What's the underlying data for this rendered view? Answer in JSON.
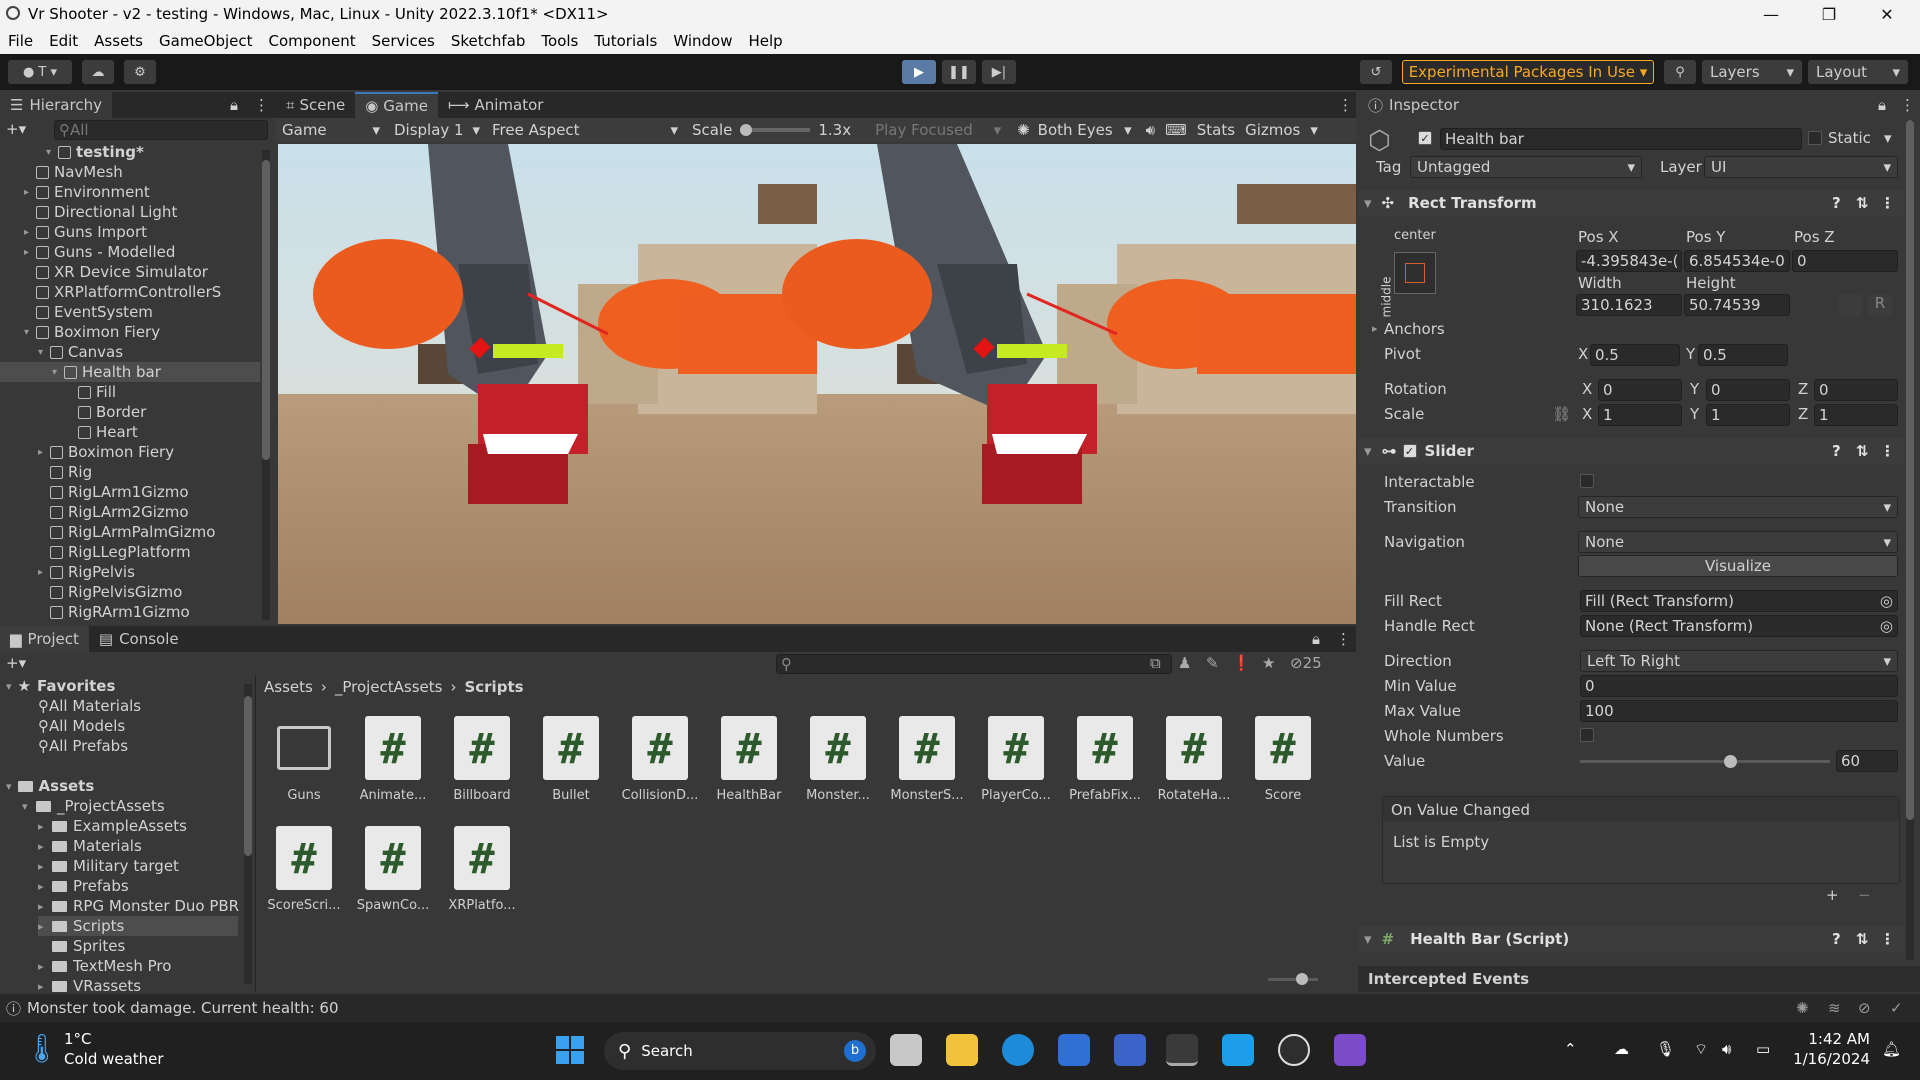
{
  "window": {
    "title": "Vr Shooter - v2 - testing - Windows, Mac, Linux - Unity 2022.3.10f1* <DX11>"
  },
  "menu": [
    "File",
    "Edit",
    "Assets",
    "GameObject",
    "Component",
    "Services",
    "Sketchfab",
    "Tools",
    "Tutorials",
    "Window",
    "Help"
  ],
  "toolbar": {
    "account": "T",
    "experimental": "Experimental Packages In Use",
    "layers": "Layers",
    "layout": "Layout"
  },
  "hierarchy": {
    "title": "Hierarchy",
    "search_placeholder": "All",
    "items": [
      {
        "label": "testing*",
        "depth": 0
      },
      {
        "label": "NavMesh",
        "depth": 1
      },
      {
        "label": "Environment",
        "depth": 1
      },
      {
        "label": "Directional Light",
        "depth": 1
      },
      {
        "label": "Guns Import",
        "depth": 1
      },
      {
        "label": "Guns - Modelled",
        "depth": 1
      },
      {
        "label": "XR Device Simulator",
        "depth": 1
      },
      {
        "label": "XRPlatformControllerS",
        "depth": 1
      },
      {
        "label": "EventSystem",
        "depth": 1
      },
      {
        "label": "Boximon Fiery",
        "depth": 1
      },
      {
        "label": "Canvas",
        "depth": 2
      },
      {
        "label": "Health bar",
        "depth": 3
      },
      {
        "label": "Fill",
        "depth": 4
      },
      {
        "label": "Border",
        "depth": 4
      },
      {
        "label": "Heart",
        "depth": 4
      },
      {
        "label": "Boximon Fiery",
        "depth": 2
      },
      {
        "label": "Rig",
        "depth": 2
      },
      {
        "label": "RigLArm1Gizmo",
        "depth": 2
      },
      {
        "label": "RigLArm2Gizmo",
        "depth": 2
      },
      {
        "label": "RigLArmPalmGizmo",
        "depth": 2
      },
      {
        "label": "RigLLegPlatform",
        "depth": 2
      },
      {
        "label": "RigPelvis",
        "depth": 2
      },
      {
        "label": "RigPelvisGizmo",
        "depth": 2
      },
      {
        "label": "RigRArm1Gizmo",
        "depth": 2
      }
    ]
  },
  "view_tabs": [
    "Scene",
    "Game",
    "Animator"
  ],
  "game_bar": {
    "mode": "Game",
    "display": "Display 1",
    "aspect": "Free Aspect",
    "scale_label": "Scale",
    "scale_value": "1.3x",
    "play_focused": "Play Focused",
    "eyes": "Both Eyes",
    "stats": "Stats",
    "gizmos": "Gizmos"
  },
  "project": {
    "tabs": [
      "Project",
      "Console"
    ],
    "count": "25",
    "breadcrumb": [
      "Assets",
      "_ProjectAssets",
      "Scripts"
    ],
    "favorites_title": "Favorites",
    "favorites": [
      "All Materials",
      "All Models",
      "All Prefabs"
    ],
    "assets_title": "Assets",
    "folders": [
      "_ProjectAssets",
      "ExampleAssets",
      "Materials",
      "Military target",
      "Prefabs",
      "RPG Monster Duo PBR",
      "Scripts",
      "Sprites",
      "TextMesh Pro",
      "VRassets"
    ],
    "items": [
      "Guns",
      "Animate...",
      "Billboard",
      "Bullet",
      "CollisionD...",
      "HealthBar",
      "Monster...",
      "MonsterS...",
      "PlayerCo...",
      "PrefabFix...",
      "RotateHa...",
      "Score",
      "ScoreScri...",
      "SpawnCo...",
      "XRPlatfo..."
    ]
  },
  "inspector": {
    "title": "Inspector",
    "object_name": "Health bar",
    "static_label": "Static",
    "tag_label": "Tag",
    "tag_value": "Untagged",
    "layer_label": "Layer",
    "layer_value": "UI",
    "rect": {
      "title": "Rect Transform",
      "anchor_h": "center",
      "anchor_v": "middle",
      "posx_label": "Pos X",
      "posy_label": "Pos Y",
      "posz_label": "Pos Z",
      "posx": "-4.395843e-(",
      "posy": "6.854534e-0",
      "posz": "0",
      "width_label": "Width",
      "height_label": "Height",
      "width": "310.1623",
      "height": "50.74539",
      "anchors": "Anchors",
      "pivot": "Pivot",
      "pivot_x": "0.5",
      "pivot_y": "0.5",
      "rotation": "Rotation",
      "rot_x": "0",
      "rot_y": "0",
      "rot_z": "0",
      "scale": "Scale",
      "scale_x": "1",
      "scale_y": "1",
      "scale_z": "1",
      "x": "X",
      "y": "Y",
      "z": "Z",
      "r": "R"
    },
    "slider": {
      "title": "Slider",
      "interactable": "Interactable",
      "transition": "Transition",
      "transition_value": "None",
      "navigation": "Navigation",
      "navigation_value": "None",
      "visualize": "Visualize",
      "fill_rect": "Fill Rect",
      "fill_rect_value": "Fill (Rect Transform)",
      "handle_rect": "Handle Rect",
      "handle_rect_value": "None (Rect Transform)",
      "direction": "Direction",
      "direction_value": "Left To Right",
      "min": "Min Value",
      "min_value": "0",
      "max": "Max Value",
      "max_value": "100",
      "whole": "Whole Numbers",
      "value": "Value",
      "value_value": "60",
      "event": "On Value Changed",
      "event_empty": "List is Empty"
    },
    "script": "Health Bar (Script)",
    "intercepted": "Intercepted Events"
  },
  "status": {
    "message": "Monster took damage. Current health: 60"
  },
  "taskbar": {
    "temp": "1°C",
    "weather": "Cold weather",
    "search": "Search",
    "time": "1:42 AM",
    "date": "1/16/2024"
  },
  "colors": {
    "accent": "#3a79bb",
    "experimental": "#f7a825",
    "health": "#c6ea22"
  }
}
